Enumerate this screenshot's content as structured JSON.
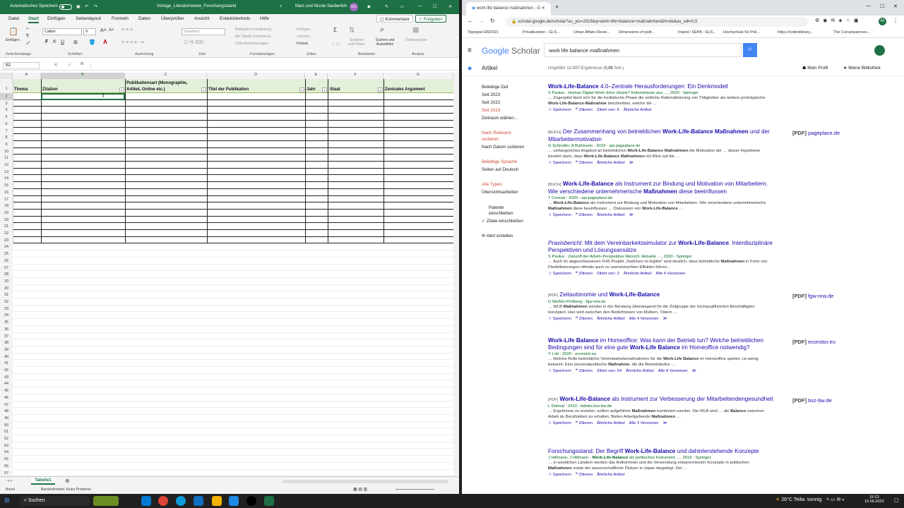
{
  "excel": {
    "autosave_label": "Automatisches Speichern",
    "doc_title": "Vorlage_Literaturreview_Forschungsstand",
    "user_name": "Marc und Nicole Sauberlich",
    "user_initials": "MS",
    "menu": [
      "Datei",
      "Start",
      "Einfügen",
      "Seitenlayout",
      "Formeln",
      "Daten",
      "Überprüfen",
      "Ansicht",
      "Entwicklertools",
      "Hilfe"
    ],
    "comment_btn": "Kommentare",
    "share_btn": "Freigeben",
    "ribbon": {
      "paste": "Einfügen",
      "font_name": "Calibri",
      "font_size": "9",
      "number_format": "Standard",
      "cond_format": "Bedingte Formatierung",
      "as_table": "Als Tabelle formatieren",
      "cell_styles": "Zellenformatvorlagen",
      "insert": "Einfügen",
      "delete": "Löschen",
      "format": "Format",
      "sort_filter": "Sortieren und Filtern",
      "find_select": "Suchen und Auswählen",
      "data_analysis": "Datenanalyse",
      "groups": [
        "Zwischenablage",
        "Schriftart",
        "Ausrichtung",
        "Zahl",
        "Formatvorlagen",
        "Zellen",
        "Bearbeiten",
        "Analyse"
      ]
    },
    "name_box": "B2",
    "fx": "fx",
    "columns": [
      "A",
      "B",
      "C",
      "D",
      "E",
      "F",
      "G"
    ],
    "headers": {
      "thema": "Thema",
      "zitation": "Zitation",
      "publikationsart_1": "Publikationsart (Monographie,",
      "publikationsart_2": "Artikel, Online etc.)",
      "titel": "Titel der Publikation",
      "jahr": "Jahr",
      "staat": "Staat",
      "argument": "Zentrales Argument"
    },
    "row_count": 57,
    "sheet_tab": "Tabelle1",
    "status_left": "Bereit",
    "status_access": "Barrierefreiheit: Keine Probleme"
  },
  "chrome": {
    "tab_title": "work life balance maßnahmen - G",
    "url": "scholar.google.de/scholar?as_ylo=2019&q=work+life+balance+maßnahmen&hl=de&as_sdt=0,5",
    "bookmarks": [
      "Tippspiel EM2021",
      "Privatkunden - GLS...",
      "Urban Affairs Revie...",
      "Dimensions of polit...",
      "Inland / SEPA - GLS...",
      "Hochschule für Poli...",
      "https://onlinelibrary...",
      "The Consequences..."
    ],
    "logo_google": "Google",
    "logo_scholar": "Scholar",
    "search_value": "work life balance maßnahmen",
    "section": "Artikel",
    "result_count": "Ungefähr 13.800 Ergebnisse (",
    "result_time": "0,08",
    "result_time_unit": " Sek.)",
    "my_profile": "Mein Profil",
    "my_library": "Meine Bibliothek",
    "sidebar": {
      "time": [
        "Beliebige Zeit",
        "Seit 2023",
        "Seit 2022",
        "Seit 2019",
        "Zeitraum wählen..."
      ],
      "sort": [
        "Nach Relevanz",
        "sortieren",
        "Nach Datum sortieren"
      ],
      "lang": [
        "Beliebige Sprache",
        "Seiten auf Deutsch"
      ],
      "types": [
        "Alle Typen",
        "Übersichtsarbeiten"
      ],
      "patents_1": "Patente",
      "patents_2": "einschließen",
      "citations": "Zitate einschließen",
      "alert": "Alert erstellen"
    },
    "results": [
      {
        "tag": "",
        "title_html": "<b>Work-Life-Balance</b> 4.0–Zentrale Herausforderungen: Ein Denkmodell",
        "authors": "S Paulus - Human Digital Work–Eine Utopie? Erkenntnisse aus …, 2020 - Springer",
        "snippet": "… Zugespitzt lässt sich für die fordistische Phase die zeitliche Rationalisierung von Tätigkeiten als weitere prototypische <b>Work-Life-Balance-Maßnahme</b> beschreiben, welche die …",
        "links": [
          "☆ Speichern",
          "❝ Zitieren",
          "Zitiert von: 6",
          "Ähnliche Artikel"
        ],
        "pdf_tag": "",
        "pdf_src": ""
      },
      {
        "tag": "[BUCH]",
        "title_html": "Der Zusammenhang von betrieblichen <b>Work-Life-Balance Maßnahmen</b> und der Mitarbeitermotivation",
        "authors": "G Schindler, A Bußmann - 2019 - api.pageplace.de",
        "snippet": "… umfangreiches Angebot an betrieblichen <b>Work-Life-Balance Maßnahmen</b> die Motivation der … dieser Hypothese besteht darin, dass <b>Work-Life-Balance Maßnahmen</b> mit Blick auf die …",
        "links": [
          "☆ Speichern",
          "❝ Zitieren",
          "Ähnliche Artikel",
          "≫"
        ],
        "pdf_tag": "[PDF]",
        "pdf_src": "pageplace.de"
      },
      {
        "tag": "[BUCH]",
        "title_html": "<b>Work-Life-Balance</b> als Instrument zur Bindung und Motivation von Mitarbeitern. Wie verschiedene unternehmerische <b>Maßnahmen</b> diese beeinflussen",
        "authors": "T Conrad - 2020 - api.pageplace.de",
        "snippet": "… <b>Work-Life-Balance</b> als Instrument zur Bindung und Motivation von Mitarbeitern. Wie verschiedene unternehmerische <b>Maßnahmen</b> diese beeinflussen … Diskussion von <b>Work-Life-Balance</b> …",
        "links": [
          "☆ Speichern",
          "❝ Zitieren",
          "Ähnliche Artikel",
          "≫"
        ],
        "pdf_tag": "",
        "pdf_src": ""
      },
      {
        "tag": "",
        "title_html": "<i>Praxisbericht:</i> Mit dem Vereinbarkeitssimulator zur <b>Work-Life-Balance</b>. Interdisziplinäre Perspektiven und Lösungsansätze",
        "authors": "S Paulus - Zukunft der Arbeit–Perspektive Mensch: Aktuelle …, 2020 - Springer",
        "snippet": "… Auch im abgeschlossenen FHS Projekt „Switchen ist legitim“ wird deutlich, dass betriebliche <b>Maßnahmen</b> in Form von Flexibilisierungen oftmals auch zu unerwünschten Effekten führen…",
        "links": [
          "☆ Speichern",
          "❝ Zitieren",
          "Zitiert von: 2",
          "Ähnliche Artikel",
          "Alle 4 Versionen"
        ],
        "pdf_tag": "",
        "pdf_src": ""
      },
      {
        "tag": "[PDF]",
        "title_html": "Zeitautonomie und <b>Work-Life-Balance</b>",
        "authors": "D Weßler-Poßberg - fgw-nrw.de",
        "snippet": "… WLB-<b>Maßnahmen</b> werden in der Beratung überwiegend für die Zielgruppe der hochqualifizierten Beschäftigten konzipiert. Hier wird zwischen den Bedürfnissen von Müttern, Vätern …",
        "links": [
          "☆ Speichern",
          "❝ Zitieren",
          "Ähnliche Artikel",
          "Alle 4 Versionen",
          "≫"
        ],
        "pdf_tag": "[PDF]",
        "pdf_src": "fgw-nrw.de"
      },
      {
        "tag": "",
        "title_html": "<b>Work-Life Balance</b> im Homeoffice: Was kann der Betrieb tun? Welche betrieblichen Bedingungen sind für eine gute <b>Work-Life Balance</b> im Homeoffice notwendig?",
        "authors": "Y Lott - 2020 - econstor.eu",
        "snippet": "… Welche Rolle betriebliche Vereinbarkeitsmaßnahmen für die <b>Work-Life Balance</b> im Homeoffice spielen, ist wenig bekannt. Eine personalpolitische <b>Maßnahme</b>, die die Betriebskultur …",
        "links": [
          "☆ Speichern",
          "❝ Zitieren",
          "Zitiert von: 54",
          "Ähnliche Artikel",
          "Alle 8 Versionen",
          "≫"
        ],
        "pdf_tag": "[PDF]",
        "pdf_src": "econstor.eu"
      },
      {
        "tag": "[PDF]",
        "title_html": "<b>Work-Life-Balance</b> als Instrument zur Verbesserung der Mitarbeitendengesundheit",
        "authors": "L Dohnal - 2022 - kidoks.bsz-bw.de",
        "snippet": "… Ergebnisse zu erzielen, sollten aufgeführte <b>Maßnahmen</b> kombiniert werden. Die WLB wird … die <b>Balance</b> zwischen Arbeit du Berufsleben zu erhalten. Bieten Arbeitgebende <b>Maßnahmen</b> …",
        "links": [
          "☆ Speichern",
          "❝ Zitieren",
          "Ähnliche Artikel",
          "Alle 3 Versionen",
          "≫"
        ],
        "pdf_tag": "[PDF]",
        "pdf_src": "bsz-bw.de"
      },
      {
        "tag": "",
        "title_html": "Forschungsstand: Der Begriff <b>Work-Life-Balance</b> und dahinterstehende Konzepte",
        "authors": "J Hillmann, J Hillmann - <b>Work-Life-Balance</b> als politisches Instrument …, 2019 - Springer",
        "snippet": "… in westlichen Ländern werden das Aufkommen und die Verwendung entsprechender Konzepte in politischen <b>Maßnahmen</b> sowie der wissenschaftliche Diskurs in Japan dargelegt. Ziel …",
        "links": [
          "☆ Speichern",
          "❝ Zitieren",
          "Ähnliche Artikel"
        ],
        "pdf_tag": "",
        "pdf_src": ""
      }
    ]
  },
  "taskbar": {
    "search": "Suchen",
    "weather": "26°C  Teilw. sonnig",
    "time": "15:23",
    "date": "19.06.2023"
  },
  "colors": {
    "excel_green": "#1e7145",
    "link": "#1a0dab",
    "scholar_blue": "#4285f4"
  }
}
